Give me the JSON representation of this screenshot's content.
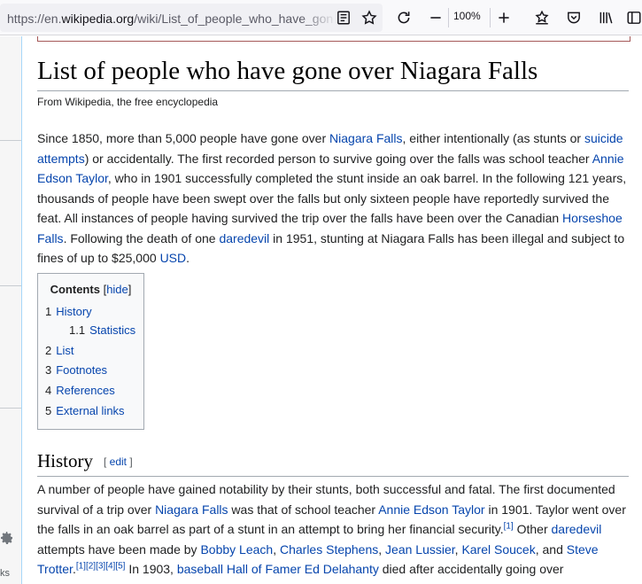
{
  "browser": {
    "url_prefix": "https://en.",
    "url_domain": "wikipedia.org",
    "url_path": "/wiki/List_of_people_who_have_gone_over_Niagara_Falls",
    "zoom": "100%"
  },
  "sidebar": {
    "partial_label": "ks"
  },
  "article": {
    "title": "List of people who have gone over Niagara Falls",
    "tagline": "From Wikipedia, the free encyclopedia",
    "intro": [
      {
        "t": "Since 1850, more than 5,000 people have gone over "
      },
      {
        "t": "Niagara Falls",
        "link": true
      },
      {
        "t": ", either intentionally (as stunts or "
      },
      {
        "t": "suicide attempts",
        "link": true
      },
      {
        "t": ") or accidentally. The first recorded person to survive going over the falls was school teacher "
      },
      {
        "t": "Annie Edson Taylor",
        "link": true
      },
      {
        "t": ", who in 1901 successfully completed the stunt inside an oak barrel. In the following 121 years, thousands of people have been swept over the falls but only sixteen people have reportedly survived the feat. All instances of people having survived the trip over the falls have been over the Canadian "
      },
      {
        "t": "Horseshoe Falls",
        "link": true
      },
      {
        "t": ". Following the death of one "
      },
      {
        "t": "daredevil",
        "link": true
      },
      {
        "t": " in 1951, stunting at Niagara Falls has been illegal and subject to fines of up to $25,000 "
      },
      {
        "t": "USD",
        "link": true
      },
      {
        "t": "."
      }
    ],
    "toc": {
      "title": "Contents",
      "hide_open": "[",
      "hide_label": "hide",
      "hide_close": "]",
      "items": [
        {
          "num": "1",
          "label": "History"
        },
        {
          "num": "1.1",
          "label": "Statistics"
        },
        {
          "num": "2",
          "label": "List"
        },
        {
          "num": "3",
          "label": "Footnotes"
        },
        {
          "num": "4",
          "label": "References"
        },
        {
          "num": "5",
          "label": "External links"
        }
      ]
    },
    "history_heading": "History",
    "edit_open": "[ ",
    "edit_label": "edit",
    "edit_close": " ]",
    "history_para": [
      {
        "t": "A number of people have gained notability by their stunts, both successful and fatal. The first documented survival of a trip over "
      },
      {
        "t": "Niagara Falls",
        "link": true
      },
      {
        "t": " was that of school teacher "
      },
      {
        "t": "Annie Edson Taylor",
        "link": true
      },
      {
        "t": " in 1901. Taylor went over the falls in an oak barrel as part of a stunt in an attempt to bring her financial security."
      },
      {
        "t": "[1]",
        "link": true,
        "sup": true
      },
      {
        "t": " Other "
      },
      {
        "t": "daredevil",
        "link": true
      },
      {
        "t": " attempts have been made by "
      },
      {
        "t": "Bobby Leach",
        "link": true
      },
      {
        "t": ", "
      },
      {
        "t": "Charles Stephens",
        "link": true
      },
      {
        "t": ", "
      },
      {
        "t": "Jean Lussier",
        "link": true
      },
      {
        "t": ", "
      },
      {
        "t": "Karel Soucek",
        "link": true
      },
      {
        "t": ", and "
      },
      {
        "t": "Steve Trotter",
        "link": true
      },
      {
        "t": ".",
        "link": false
      },
      {
        "t": "[1]",
        "link": true,
        "sup": true
      },
      {
        "t": "[2]",
        "link": true,
        "sup": true
      },
      {
        "t": "[3]",
        "link": true,
        "sup": true
      },
      {
        "t": "[4]",
        "link": true,
        "sup": true
      },
      {
        "t": "[5]",
        "link": true,
        "sup": true
      },
      {
        "t": " In 1903, "
      },
      {
        "t": "baseball Hall of Famer Ed Delahanty",
        "link": true
      },
      {
        "t": " died after accidentally going over"
      }
    ]
  }
}
